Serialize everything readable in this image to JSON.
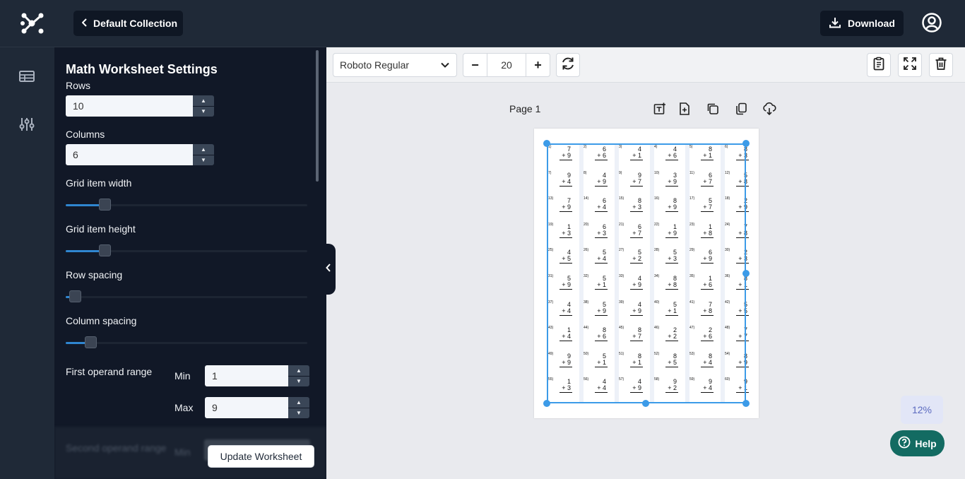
{
  "header": {
    "back_label": "Default Collection",
    "download_label": "Download"
  },
  "settings": {
    "title": "Math Worksheet Settings",
    "rows_label": "Rows",
    "rows_value": "10",
    "columns_label": "Columns",
    "columns_value": "6",
    "grid_item_width_label": "Grid item width",
    "grid_item_width_level": 0.13,
    "grid_item_height_label": "Grid item height",
    "grid_item_height_level": 0.13,
    "row_spacing_label": "Row spacing",
    "row_spacing_level": 0.0,
    "column_spacing_label": "Column spacing",
    "column_spacing_level": 0.07,
    "first_operand_label": "First operand range",
    "min_label": "Min",
    "min_value": "1",
    "max_label": "Max",
    "max_value": "9",
    "second_operand_label": "Second operand range",
    "second_min_label": "Min",
    "update_label": "Update Worksheet"
  },
  "toolbar": {
    "font": "Roboto Regular",
    "font_size": "20"
  },
  "canvas": {
    "page_label": "Page 1",
    "zoom": "12%",
    "help_label": "Help"
  },
  "worksheet": {
    "operator": "+",
    "problems": [
      [
        7,
        9
      ],
      [
        6,
        6
      ],
      [
        4,
        1
      ],
      [
        4,
        6
      ],
      [
        8,
        1
      ],
      [
        8,
        3
      ],
      [
        9,
        4
      ],
      [
        4,
        9
      ],
      [
        9,
        7
      ],
      [
        3,
        9
      ],
      [
        6,
        7
      ],
      [
        5,
        8
      ],
      [
        7,
        9
      ],
      [
        6,
        4
      ],
      [
        8,
        3
      ],
      [
        8,
        9
      ],
      [
        5,
        7
      ],
      [
        2,
        9
      ],
      [
        1,
        3
      ],
      [
        6,
        3
      ],
      [
        6,
        7
      ],
      [
        1,
        9
      ],
      [
        1,
        8
      ],
      [
        7,
        8
      ],
      [
        4,
        5
      ],
      [
        5,
        4
      ],
      [
        5,
        2
      ],
      [
        5,
        3
      ],
      [
        6,
        9
      ],
      [
        2,
        3
      ],
      [
        5,
        9
      ],
      [
        5,
        1
      ],
      [
        4,
        9
      ],
      [
        8,
        8
      ],
      [
        1,
        6
      ],
      [
        8,
        1
      ],
      [
        4,
        4
      ],
      [
        5,
        9
      ],
      [
        4,
        9
      ],
      [
        5,
        1
      ],
      [
        7,
        8
      ],
      [
        5,
        5
      ],
      [
        1,
        4
      ],
      [
        8,
        6
      ],
      [
        8,
        7
      ],
      [
        2,
        2
      ],
      [
        2,
        6
      ],
      [
        7,
        7
      ],
      [
        9,
        9
      ],
      [
        5,
        1
      ],
      [
        8,
        1
      ],
      [
        8,
        5
      ],
      [
        8,
        4
      ],
      [
        8,
        9
      ],
      [
        1,
        3
      ],
      [
        4,
        4
      ],
      [
        4,
        9
      ],
      [
        9,
        2
      ],
      [
        9,
        4
      ],
      [
        9,
        1
      ]
    ]
  },
  "colors": {
    "accent": "#3c9be8",
    "help": "#136b62",
    "panel": "#111827"
  }
}
